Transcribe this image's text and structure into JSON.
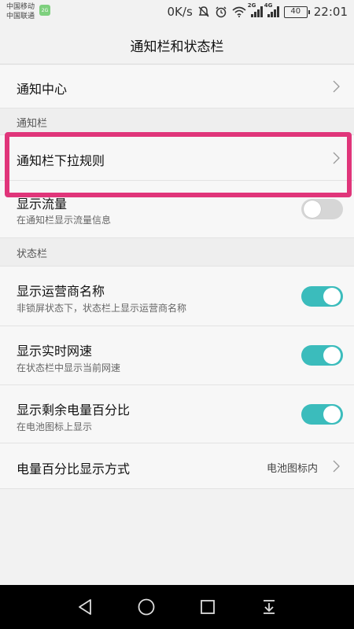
{
  "status_bar": {
    "carrier_1": "中国移动",
    "carrier_2": "中国联通",
    "sim_badge": "2G",
    "net_speed": "0K/s",
    "signal_1_label": "2G",
    "signal_2_label": "4G",
    "battery_level": "40",
    "time": "22:01",
    "icons": [
      "no-notification-icon",
      "alarm-icon",
      "wifi-icon",
      "signal-icon",
      "signal-icon",
      "battery-icon"
    ]
  },
  "header": {
    "title": "通知栏和状态栏"
  },
  "notification_center": {
    "label": "通知中心"
  },
  "notification_section": {
    "label": "通知栏",
    "items": [
      {
        "label": "通知栏下拉规则"
      },
      {
        "label": "显示流量",
        "sub": "在通知栏显示流量信息",
        "toggle": false
      }
    ]
  },
  "status_section": {
    "label": "状态栏",
    "items": [
      {
        "label": "显示运营商名称",
        "sub": "非锁屏状态下，状态栏上显示运营商名称",
        "toggle": true
      },
      {
        "label": "显示实时网速",
        "sub": "在状态栏中显示当前网速",
        "toggle": true
      },
      {
        "label": "显示剩余电量百分比",
        "sub": "在电池图标上显示",
        "toggle": true
      },
      {
        "label": "电量百分比显示方式",
        "value": "电池图标内"
      }
    ]
  },
  "colors": {
    "accent_toggle": "#3bbcbc",
    "highlight_border": "#e0357a"
  },
  "nav_bar": {
    "icons": [
      "back-icon",
      "home-icon",
      "recents-icon",
      "notification-pull-icon"
    ]
  }
}
